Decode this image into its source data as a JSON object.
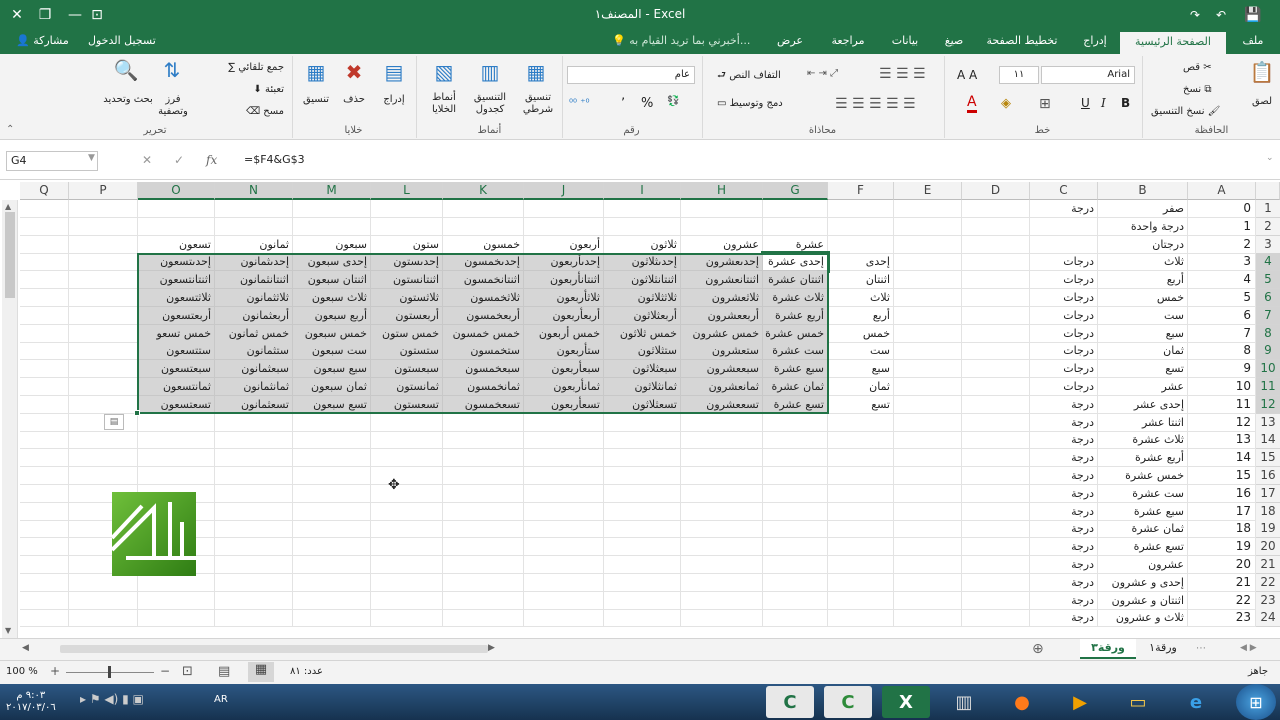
{
  "window": {
    "title": "المصنف١ - Excel",
    "share": "مشاركة",
    "login": "تسجيل الدخول",
    "tell_me": "أخبرني بما تريد القيام به...",
    "controls": {
      "close": "✕",
      "restore": "❐",
      "minimize": "—",
      "ribbon_opts": "⊡"
    }
  },
  "ribbon_tabs": [
    "ملف",
    "الصفحة الرئيسية",
    "إدراج",
    "تخطيط الصفحة",
    "صيغ",
    "بيانات",
    "مراجعة",
    "عرض"
  ],
  "ribbon": {
    "clipboard": {
      "label": "الحافظة",
      "paste": "لصق",
      "cut": "قص",
      "copy": "نسخ",
      "format_painter": "نسخ التنسيق"
    },
    "font": {
      "label": "خط",
      "name": "Arial",
      "size": "١١",
      "bold": "B",
      "italic": "I",
      "underline": "U"
    },
    "alignment": {
      "label": "محاذاة",
      "wrap": "التفاف النص",
      "merge": "دمج وتوسيط"
    },
    "number": {
      "label": "رقم",
      "format": "عام",
      "percent": "%",
      "comma": "٬"
    },
    "styles": {
      "label": "أنماط",
      "conditional": "تنسيق شرطي",
      "as_table": "التنسيق كجدول",
      "cell_styles": "أنماط الخلايا"
    },
    "cells": {
      "label": "خلايا",
      "insert": "إدراج",
      "delete": "حذف",
      "format": "تنسيق"
    },
    "editing": {
      "label": "تحرير",
      "autosum": "جمع تلقائي",
      "fill": "تعبئة",
      "clear": "مسح",
      "sort": "فرز وتصفية",
      "find": "بحث وتحديد"
    }
  },
  "formula_bar": {
    "name_box": "G4",
    "fx": "fx",
    "formula": "=$F4&G$3"
  },
  "columns": [
    "A",
    "B",
    "C",
    "D",
    "E",
    "F",
    "G",
    "H",
    "I",
    "J",
    "K",
    "L",
    "M",
    "N",
    "O",
    "P",
    "Q"
  ],
  "rows": {
    "numbers": [
      "1",
      "2",
      "3",
      "4",
      "5",
      "6",
      "7",
      "8",
      "9",
      "10",
      "11",
      "12",
      "13",
      "14",
      "15",
      "16",
      "17",
      "18",
      "19",
      "20",
      "21",
      "22",
      "23"
    ],
    "col_a": [
      "0",
      "1",
      "2",
      "3",
      "4",
      "5",
      "6",
      "7",
      "8",
      "9",
      "10",
      "11",
      "12",
      "13",
      "14",
      "15",
      "16",
      "17",
      "18",
      "19",
      "20",
      "21",
      "22",
      "23"
    ],
    "col_b": [
      "صفر",
      "درجة واحدة",
      "درجتان",
      "ثلاث",
      "أربع",
      "خمس",
      "ست",
      "سبع",
      "ثمان",
      "تسع",
      "عشر",
      "إحدى عشر",
      "اثنتا عشر",
      "ثلاث عشرة",
      "أربع عشرة",
      "خمس عشرة",
      "ست عشرة",
      "سبع عشرة",
      "ثمان عشرة",
      "تسع عشرة",
      "عشرون",
      "إحدى و عشرون",
      "اثنتان و عشرون",
      "ثلاث و عشرون"
    ],
    "col_c": [
      "درجة",
      "",
      "",
      "درجات",
      "درجات",
      "درجات",
      "درجات",
      "درجات",
      "درجات",
      "درجات",
      "درجات",
      "درجة",
      "درجة",
      "درجة",
      "درجة",
      "درجة",
      "درجة",
      "درجة",
      "درجة",
      "درجة",
      "درجة",
      "درجة",
      "درجة",
      "درجة"
    ]
  },
  "table": {
    "headers": [
      "عشرة",
      "عشرون",
      "ثلاثون",
      "أربعون",
      "خمسون",
      "ستون",
      "سبعون",
      "ثمانون",
      "تسعون"
    ],
    "row_labels": [
      "إحدى",
      "اثنتان",
      "ثلاث",
      "أربع",
      "خمس",
      "ست",
      "سبع",
      "ثمان",
      "تسع"
    ],
    "cells": [
      [
        "إحدى عشرة",
        "إحدىعشرون",
        "إحدىثلاثون",
        "إحدىأربعون",
        "إحدىخمسون",
        "إحدىستون",
        "إحدى سبعون",
        "إحدىثمانون",
        "إحدىتسعون"
      ],
      [
        "اثنتان عشرة",
        "اثنتانعشرون",
        "اثنتانثلاثون",
        "اثنتانأربعون",
        "اثنتانخمسون",
        "اثنتانستون",
        "اثنتان سبعون",
        "اثنتانثمانون",
        "اثنتانتسعون"
      ],
      [
        "ثلاث عشرة",
        "ثلاثعشرون",
        "ثلاثثلاثون",
        "ثلاثأربعون",
        "ثلاثخمسون",
        "ثلاثستون",
        "ثلاث سبعون",
        "ثلاثثمانون",
        "ثلاثتسعون"
      ],
      [
        "أربع عشرة",
        "أربععشرون",
        "أربعثلاثون",
        "أربعأربعون",
        "أربعخمسون",
        "أربعستون",
        "أربع سبعون",
        "أربعثمانون",
        "أربعتسعون"
      ],
      [
        "خمس عشرة",
        "خمس عشرون",
        "خمس ثلاثون",
        "خمس أربعون",
        "خمس خمسون",
        "خمس ستون",
        "خمس سبعون",
        "خمس ثمانون",
        "خمس تسعو"
      ],
      [
        "ست عشرة",
        "ستعشرون",
        "ستثلاثون",
        "ستأربعون",
        "ستخمسون",
        "ستستون",
        "ست سبعون",
        "ستثمانون",
        "ستتسعون"
      ],
      [
        "سبع عشرة",
        "سبععشرون",
        "سبعثلاثون",
        "سبعأربعون",
        "سبعخمسون",
        "سبعستون",
        "سبع سبعون",
        "سبعثمانون",
        "سبعتسعون"
      ],
      [
        "ثمان عشرة",
        "ثمانعشرون",
        "ثمانثلاثون",
        "ثمانأربعون",
        "ثمانخمسون",
        "ثمانستون",
        "ثمان سبعون",
        "ثمانثمانون",
        "ثمانتسعون"
      ],
      [
        "تسع عشرة",
        "تسععشرون",
        "تسعثلاثون",
        "تسعأربعون",
        "تسعخمسون",
        "تسعستون",
        "تسع سبعون",
        "تسعثمانون",
        "تسعتسعون"
      ]
    ]
  },
  "sheet_tabs": [
    "ورقة١",
    "ورقة٣"
  ],
  "status": {
    "mode": "جاهز",
    "count": "عدد: ٨١",
    "zoom": "100 %"
  },
  "taskbar": {
    "time": "٩:٠٣ م",
    "date": "٢٠١٧/٠٣/٠٦",
    "lang": "AR"
  },
  "colors": {
    "excel_green": "#217346",
    "selection_fill": "#d6d6d6"
  }
}
